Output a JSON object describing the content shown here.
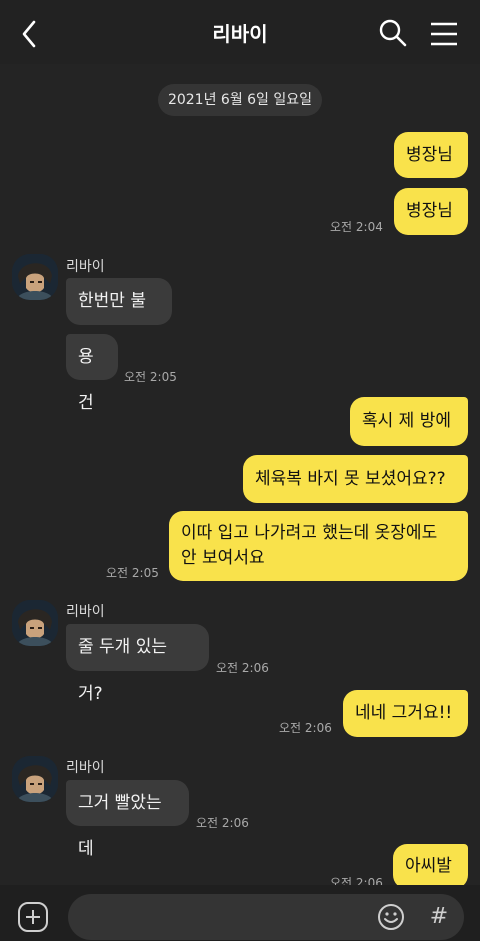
{
  "header": {
    "title": "리바이"
  },
  "date_divider": "2021년 6월 6일 일요일",
  "contact_name": "리바이",
  "messages": [
    {
      "text": "병장님"
    },
    {
      "text": "병장님",
      "time": "오전 2:04"
    },
    {
      "text": "한번만 불러"
    },
    {
      "text": "용건",
      "time": "오전 2:05"
    },
    {
      "text": "혹시 제 방에"
    },
    {
      "text": "체육복 바지 못 보셨어요??"
    },
    {
      "text_line1": "이따 입고 나가려고 했는데 옷장에도",
      "text_line2": "안 보여서요",
      "time": "오전 2:05"
    },
    {
      "text": "줄 두개 있는 거?",
      "time": "오전 2:06"
    },
    {
      "text": "네네 그거요!!",
      "time": "오전 2:06"
    },
    {
      "text": "그거 빨았는데",
      "time": "오전 2:06"
    },
    {
      "text": "아씨발",
      "time": "오전 2:06"
    }
  ],
  "composer": {
    "hash_symbol": "#"
  },
  "colors": {
    "background": "#242424",
    "mine_bubble": "#f9e24b",
    "theirs_bubble": "#3b3b3b"
  }
}
